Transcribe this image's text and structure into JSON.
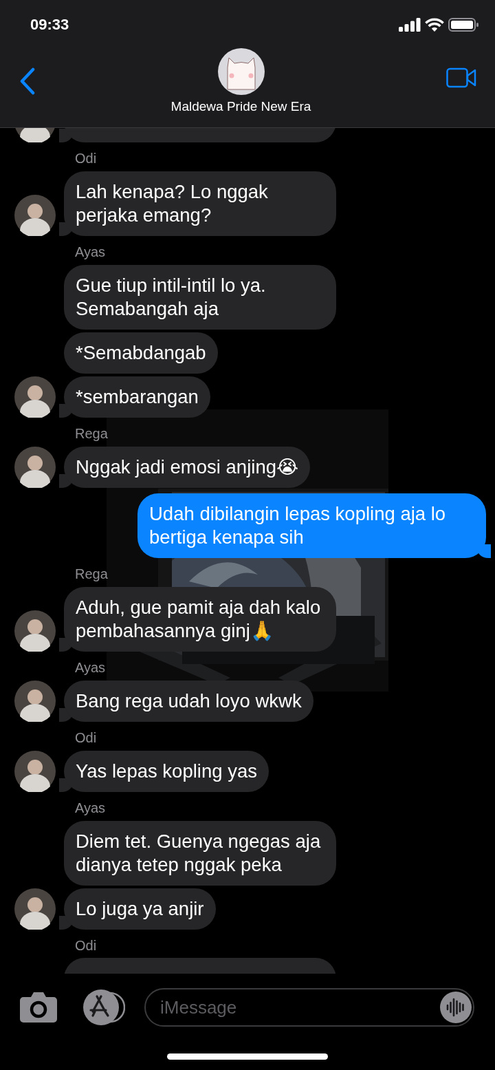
{
  "status_bar": {
    "time": "09:33"
  },
  "header": {
    "title": "Maldewa Pride New Era"
  },
  "messages": [
    {
      "kind": "partial-top",
      "avatar": true
    },
    {
      "kind": "incoming",
      "sender": "Odi",
      "text": "Lah kenapa? Lo nggak perjaka emang?",
      "avatar": true
    },
    {
      "kind": "incoming",
      "sender": "Ayas",
      "text": "Gue tiup intil-intil lo ya. Semabangah aja",
      "avatar": false
    },
    {
      "kind": "incoming",
      "text": "*Semabdangab",
      "avatar": false
    },
    {
      "kind": "incoming",
      "text": "*sembarangan",
      "avatar": true
    },
    {
      "kind": "incoming",
      "sender": "Rega",
      "text": "Nggak jadi emosi anjing😭",
      "avatar": true
    },
    {
      "kind": "outgoing",
      "text": "Udah dibilangin lepas kopling aja lo bertiga kenapa sih",
      "tail": true
    },
    {
      "kind": "incoming",
      "sender": "Rega",
      "text": "Aduh, gue pamit aja dah kalo pembahasannya ginj🙏",
      "avatar": true
    },
    {
      "kind": "incoming",
      "sender": "Ayas",
      "text": "Bang rega udah loyo wkwk",
      "avatar": true
    },
    {
      "kind": "incoming",
      "sender": "Odi",
      "text": "Yas lepas kopling yas",
      "avatar": true
    },
    {
      "kind": "incoming",
      "sender": "Ayas",
      "text": "Diem tet. Guenya ngegas aja dianya tetep nggak peka",
      "avatar": false
    },
    {
      "kind": "incoming",
      "text": "Lo juga ya anjir",
      "avatar": true
    },
    {
      "kind": "partial-bottom",
      "sender": "Odi"
    }
  ],
  "composer": {
    "placeholder": "iMessage"
  }
}
